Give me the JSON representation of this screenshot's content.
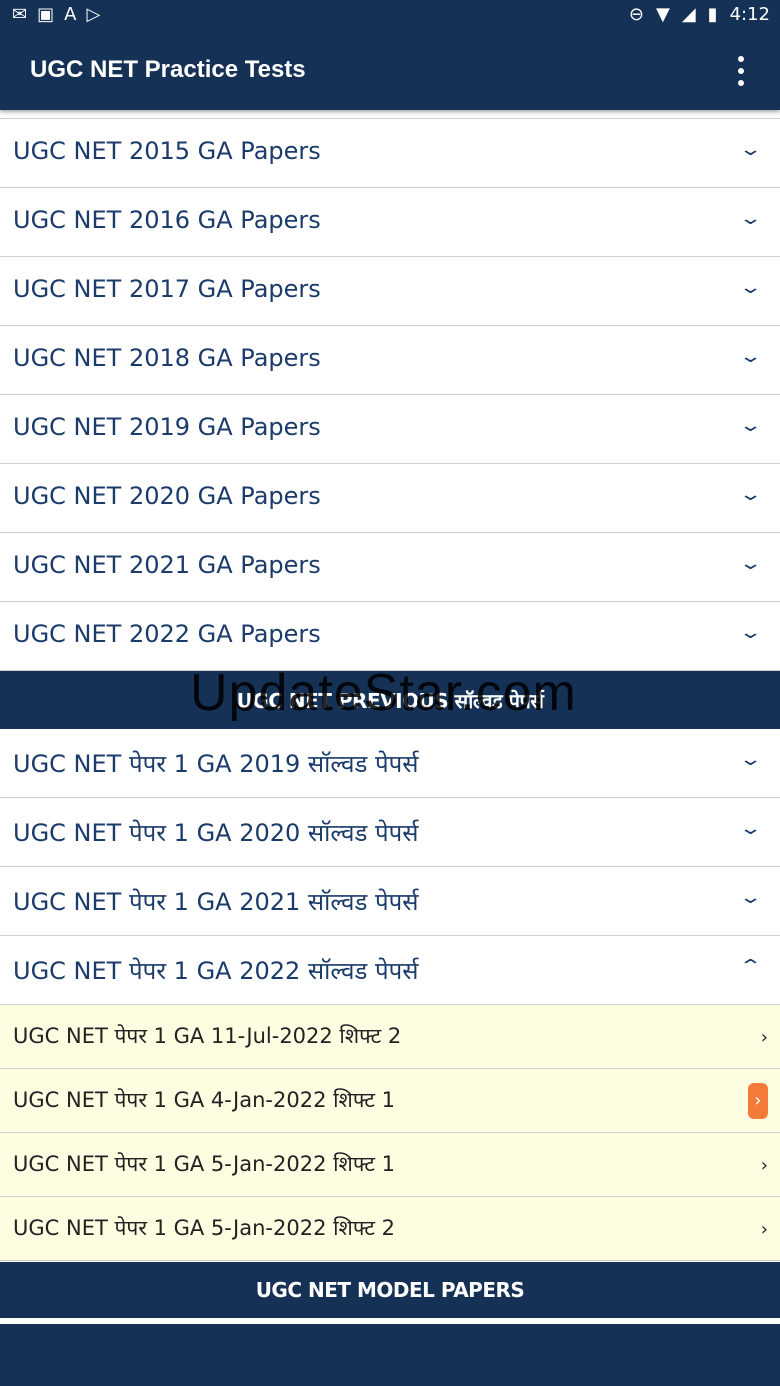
{
  "status": {
    "time": "4:12"
  },
  "appbar": {
    "title": "UGC NET Practice Tests"
  },
  "ga_papers": [
    {
      "label": "UGC NET 2015 GA Papers"
    },
    {
      "label": "UGC NET 2016 GA Papers"
    },
    {
      "label": "UGC NET 2017 GA Papers"
    },
    {
      "label": "UGC NET 2018 GA Papers"
    },
    {
      "label": "UGC NET 2019 GA Papers"
    },
    {
      "label": "UGC NET 2020 GA Papers"
    },
    {
      "label": "UGC NET 2021 GA Papers"
    },
    {
      "label": "UGC NET 2022 GA Papers"
    }
  ],
  "previous_section": {
    "title": "UGC NET PREVIOUS सॉल्वड पेपर्स",
    "watermark": "UpdateStar.com"
  },
  "hindi_papers": [
    {
      "label": "UGC NET पेपर 1 GA 2019 सॉल्वड पेपर्स",
      "expanded": false
    },
    {
      "label": "UGC NET पेपर 1 GA 2020 सॉल्वड पेपर्स",
      "expanded": false
    },
    {
      "label": "UGC NET पेपर 1 GA 2021 सॉल्वड पेपर्स",
      "expanded": false
    },
    {
      "label": "UGC NET पेपर 1 GA 2022 सॉल्वड पेपर्स",
      "expanded": true
    }
  ],
  "sub_papers": [
    {
      "label": "UGC NET पेपर 1 GA 11-Jul-2022 शिफ्ट 2"
    },
    {
      "label": "UGC NET पेपर 1 GA 4-Jan-2022 शिफ्ट 1",
      "active": true
    },
    {
      "label": "UGC NET पेपर 1 GA 5-Jan-2022 शिफ्ट 1"
    },
    {
      "label": "UGC NET पेपर 1 GA 5-Jan-2022 शिफ्ट 2"
    }
  ],
  "model_section": {
    "title": "UGC NET MODEL PAPERS"
  },
  "colors": {
    "primary": "#153256",
    "text": "#1b3b6b",
    "sub_bg": "#fdfde2",
    "accent": "#f47a3a"
  },
  "icons": {
    "chevron_down": "⌄",
    "chevron_up": "⌃",
    "chevron_right": "›"
  }
}
